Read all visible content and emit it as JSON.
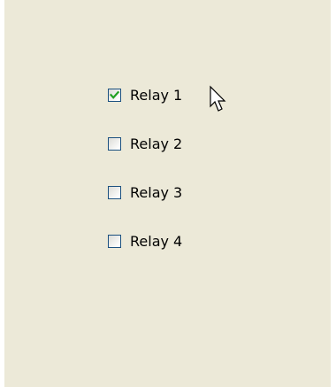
{
  "relays": [
    {
      "label": "Relay 1",
      "checked": true
    },
    {
      "label": "Relay 2",
      "checked": false
    },
    {
      "label": "Relay 3",
      "checked": false
    },
    {
      "label": "Relay 4",
      "checked": false
    }
  ],
  "colors": {
    "panel_background": "#ece9d8",
    "checkbox_border": "#1c5180",
    "checkmark": "#21a121"
  },
  "cursor_icon": "arrow-pointer-icon"
}
